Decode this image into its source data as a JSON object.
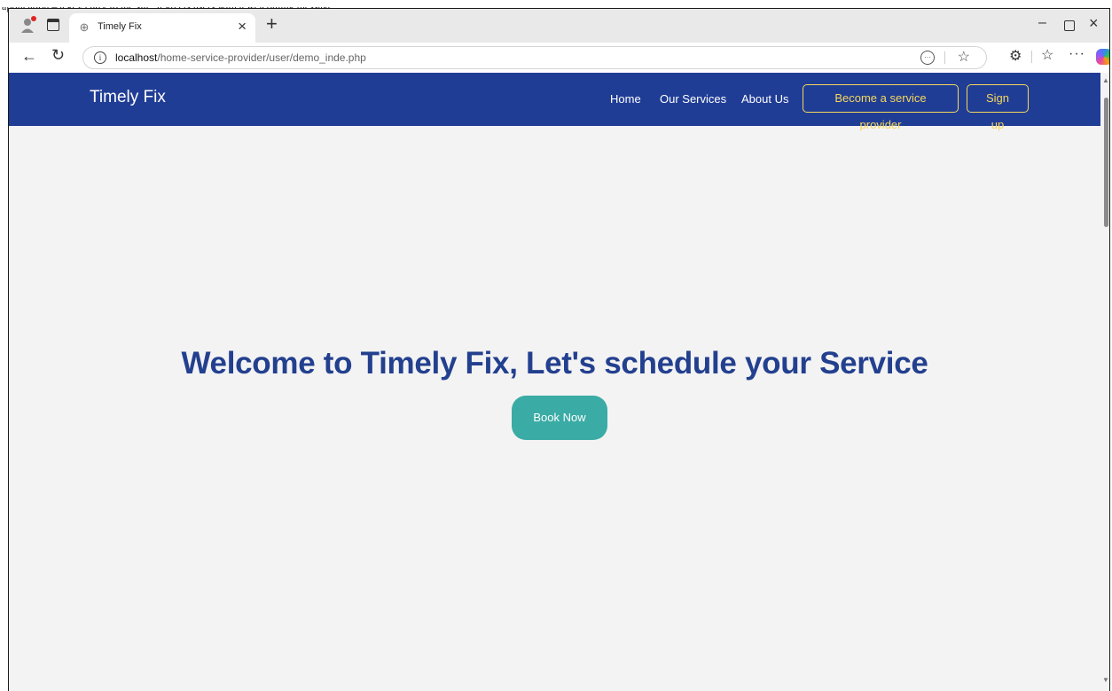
{
  "document": {
    "caption": "application – a key entry to the site: it greets users with a welcoming message"
  },
  "browser": {
    "tab_title": "Timely Fix",
    "url_host": "localhost",
    "url_path": "/home-service-provider/user/demo_inde.php"
  },
  "site": {
    "brand": "Timely Fix",
    "nav": {
      "home": "Home",
      "services": "Our Services",
      "about": "About Us",
      "provider": "Become a service provider",
      "signup": "Sign up"
    },
    "hero": {
      "title": "Welcome to Timely Fix, Let's schedule your Service",
      "cta": "Book Now"
    }
  },
  "colors": {
    "header_bg": "#203d96",
    "accent_yellow": "#f6d75a",
    "hero_title": "#23408f",
    "cta_bg": "#3aaba5",
    "page_bg": "#f3f3f3"
  },
  "icons": [
    "profile-icon",
    "tabs-icon",
    "globe-icon",
    "close-icon",
    "plus-icon",
    "back-icon",
    "reload-icon",
    "info-icon",
    "reader-icon",
    "star-icon",
    "extensions-icon",
    "favorites-icon",
    "more-icon",
    "copilot-icon"
  ]
}
